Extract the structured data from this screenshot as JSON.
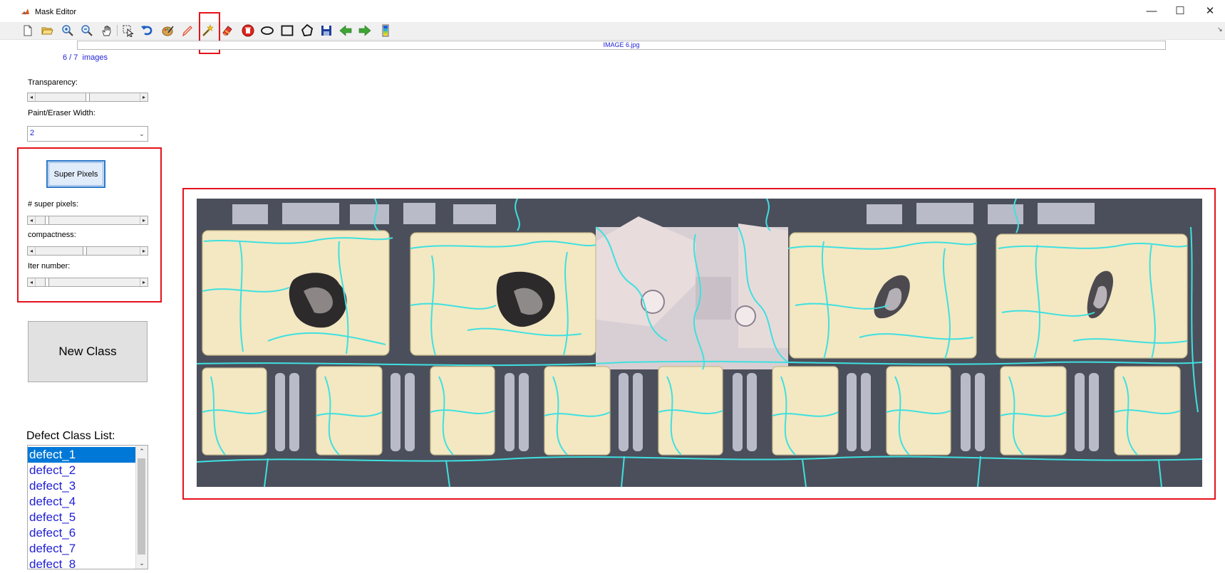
{
  "window": {
    "title": "Mask Editor",
    "controls": {
      "minimize": "—",
      "maximize": "☐",
      "close": "✕"
    }
  },
  "toolbar": {
    "tools": [
      "new-file-icon",
      "open-folder-icon",
      "zoom-in-icon",
      "zoom-out-icon",
      "pan-hand-icon",
      "select-pointer-icon",
      "undo-icon",
      "palette-icon",
      "pencil-icon",
      "magic-wand-icon",
      "eraser-icon",
      "clear-icon",
      "ellipse-icon",
      "rectangle-icon",
      "polygon-icon",
      "save-icon",
      "previous-arrow-icon",
      "next-arrow-icon",
      "colorbar-icon"
    ],
    "highlighted_tool": "magic-wand-icon"
  },
  "file": {
    "name": "IMAGE 6.jpg"
  },
  "navigation": {
    "counter": "6 / 7  images"
  },
  "controls": {
    "transparency_label": "Transparency:",
    "transparency_value": 0.5,
    "brush_label": "Paint/Eraser Width:",
    "brush_value": "2",
    "superpixel_button": "Super Pixels",
    "num_superpixels_label": "# super pixels:",
    "num_superpixels_value": 0.1,
    "compactness_label": "compactness:",
    "compactness_value": 0.47,
    "iter_label": "Iter number:",
    "iter_value": 0.1
  },
  "new_class_button": "New Class",
  "class_list": {
    "title": "Defect Class List:",
    "items": [
      "defect_1",
      "defect_2",
      "defect_3",
      "defect_4",
      "defect_5",
      "defect_6",
      "defect_7",
      "defect_8"
    ],
    "selected_index": 0
  },
  "colors": {
    "highlight": "#e5121b",
    "superpixel_boundary": "#3fe0e0",
    "pad": "#f3e8c2",
    "substrate": "#4b4f5b",
    "selection": "#0078d7",
    "link_text": "#1f1fd6"
  }
}
